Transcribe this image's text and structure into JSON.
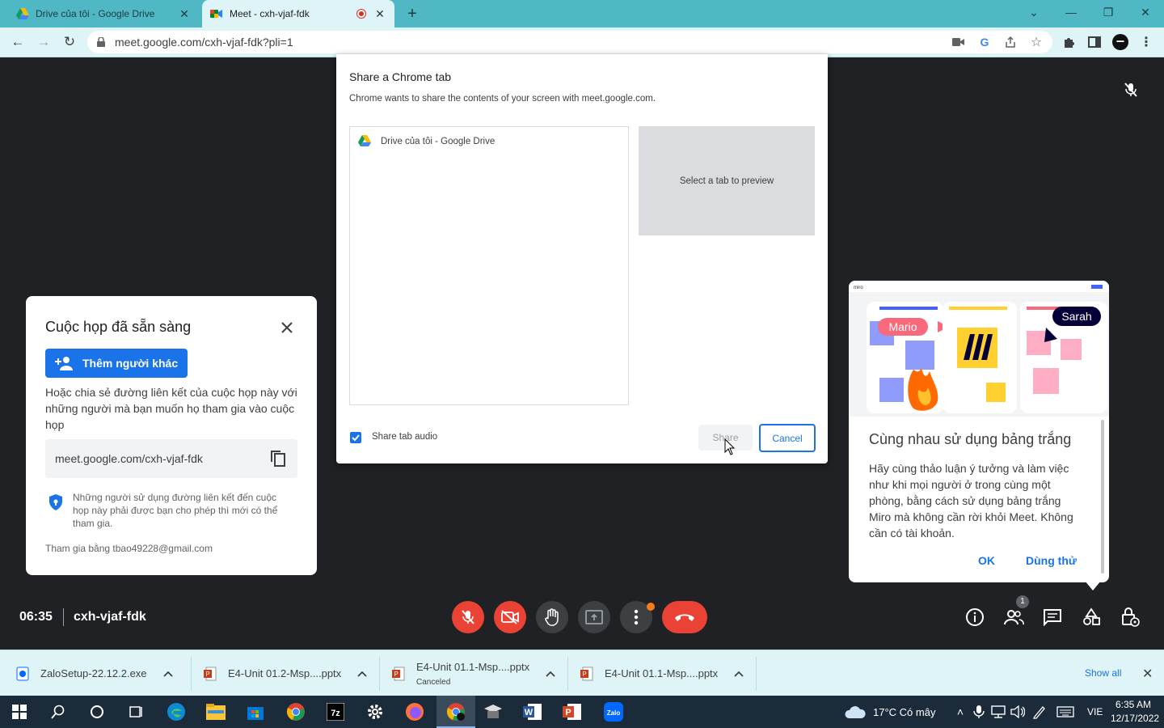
{
  "browser": {
    "tabs": [
      {
        "title": "Drive của tôi - Google Drive",
        "active": false
      },
      {
        "title": "Meet - cxh-vjaf-fdk",
        "active": true,
        "recording": true
      }
    ],
    "url": "meet.google.com/cxh-vjaf-fdk?pli=1"
  },
  "share_dialog": {
    "title": "Share a Chrome tab",
    "subtitle": "Chrome wants to share the contents of your screen with meet.google.com.",
    "tab_item": "Drive của tôi - Google Drive",
    "preview_text": "Select a tab to preview",
    "share_audio_label": "Share tab audio",
    "share_audio_checked": true,
    "share_button": "Share",
    "cancel_button": "Cancel"
  },
  "ready_card": {
    "title": "Cuộc họp đã sẵn sàng",
    "add_button": "Thêm người khác",
    "description": "Hoặc chia sẻ đường liên kết của cuộc họp này với những người mà bạn muốn họ tham gia vào cuộc họp",
    "link": "meet.google.com/cxh-vjaf-fdk",
    "note": "Những người sử dụng đường liên kết đến cuộc họp này phải được bạn cho phép thì mới có thể tham gia.",
    "joined_as": "Tham gia bằng tbao49228@gmail.com"
  },
  "whiteboard_card": {
    "title": "Cùng nhau sử dụng bảng trắng",
    "description": "Hãy cùng thảo luận ý tưởng và làm việc như khi mọi người ở trong cùng một phòng, bằng cách sử dụng bảng trắng Miro mà không cần rời khỏi Meet. Không cần có tài khoản.",
    "ok_button": "OK",
    "try_button": "Dùng thử",
    "illustration": {
      "mario_label": "Mario",
      "sarah_label": "Sarah",
      "brand_text": "miro"
    }
  },
  "meeting": {
    "time": "06:35",
    "code": "cxh-vjaf-fdk",
    "participants_count": "1"
  },
  "downloads": {
    "items": [
      {
        "name": "ZaloSetup-22.12.2.exe",
        "status": ""
      },
      {
        "name": "E4-Unit 01.2-Msp....pptx",
        "status": ""
      },
      {
        "name": "E4-Unit 01.1-Msp....pptx",
        "status": "Canceled"
      },
      {
        "name": "E4-Unit 01.1-Msp....pptx",
        "status": ""
      }
    ],
    "show_all": "Show all"
  },
  "taskbar": {
    "weather": "17°C  Có mây",
    "language": "VIE",
    "time": "6:35 AM",
    "date": "12/17/2022"
  },
  "colors": {
    "tabstrip": "#4fb8c4",
    "toolbar": "#dff4f6",
    "meet_bg": "#202124",
    "accent_blue": "#1a73e8",
    "danger_red": "#ea4335"
  }
}
